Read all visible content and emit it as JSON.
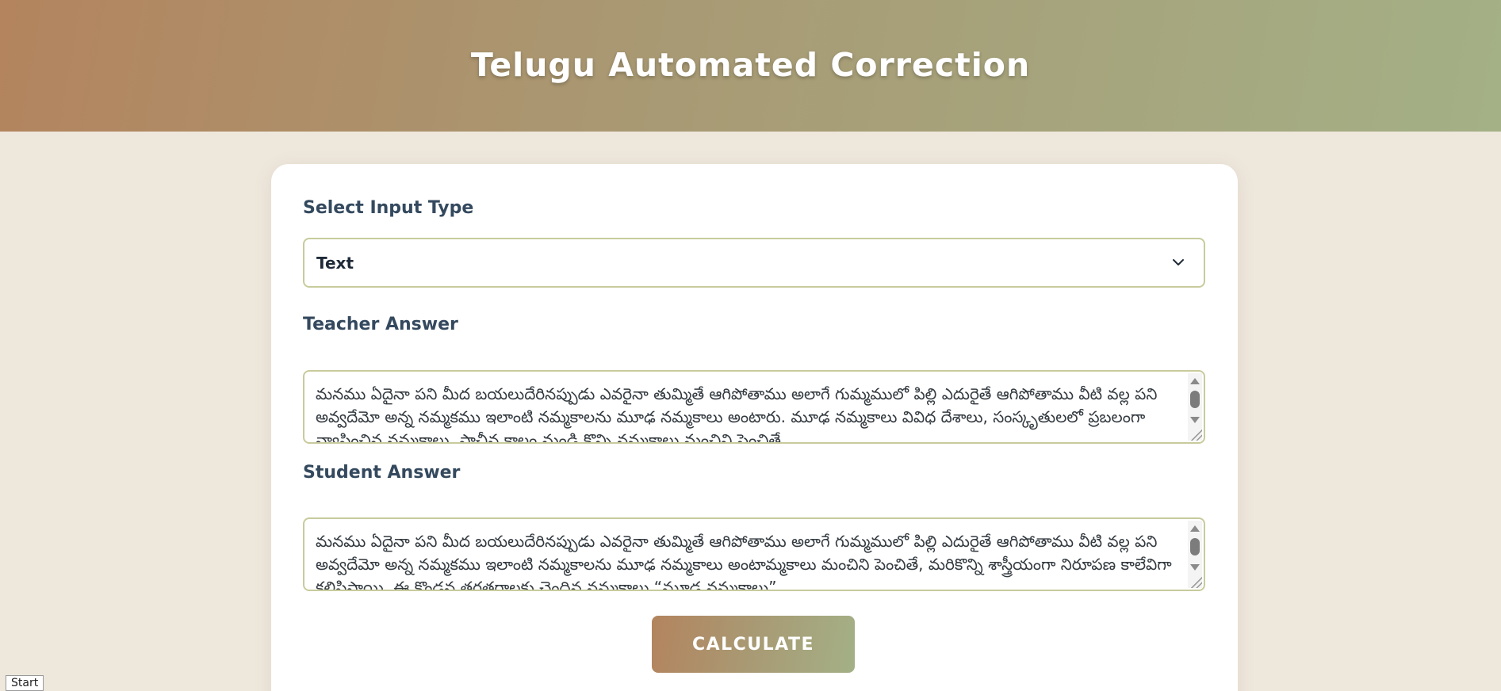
{
  "header": {
    "title": "Telugu Automated Correction"
  },
  "form": {
    "input_type_label": "Select Input Type",
    "input_type_value": "Text",
    "teacher_label": "Teacher Answer",
    "teacher_text": "మనము ఏదైనా పని మీద బయలుదేరినప్పుడు ఎవరైనా తుమ్మితే ఆగిపోతాము అలాగే గుమ్మములో పిల్లి ఎదురైతే ఆగిపోతాము వీటి వల్ల పని అవ్వదేమో అన్న నమ్మకము ఇలాంటి నమ్మకాలను మూఢ  నమ్మకాలు అంటారు. మూఢ నమ్మకాలు వివిధ దేశాలు, సంస్కృతులలో ప్రబలంగా వ్యాపించిన నమ్మకాలు. ప్రాచీన కాలం నుండి కొన్ని నమ్మకాలు మంచిని పెంచితే",
    "student_label": "Student Answer",
    "student_text": "మనము ఏదైనా పని మీద బయలుదేరినప్పుడు ఎవరైనా తుమ్మితే ఆగిపోతాము అలాగే గుమ్మములో పిల్లి ఎదురైతే ఆగిపోతాము వీటి వల్ల పని అవ్వదేమో అన్న నమ్మకము ఇలాంటి నమ్మకాలను మూఢ  నమ్మకాలు అంటామ్మకాలు మంచిని పెంచితే, మరికొన్ని శాస్త్రీయంగా నిరూపణ కాలేవిగా కలిపిస్తాయి. ఈ కొండన తరతరాలకు చెందిన నమ్మకాలు “మూఢ నమ్మకాలు”",
    "calculate_label": "CALCULATE"
  },
  "taskbar": {
    "start_label": "Start"
  }
}
